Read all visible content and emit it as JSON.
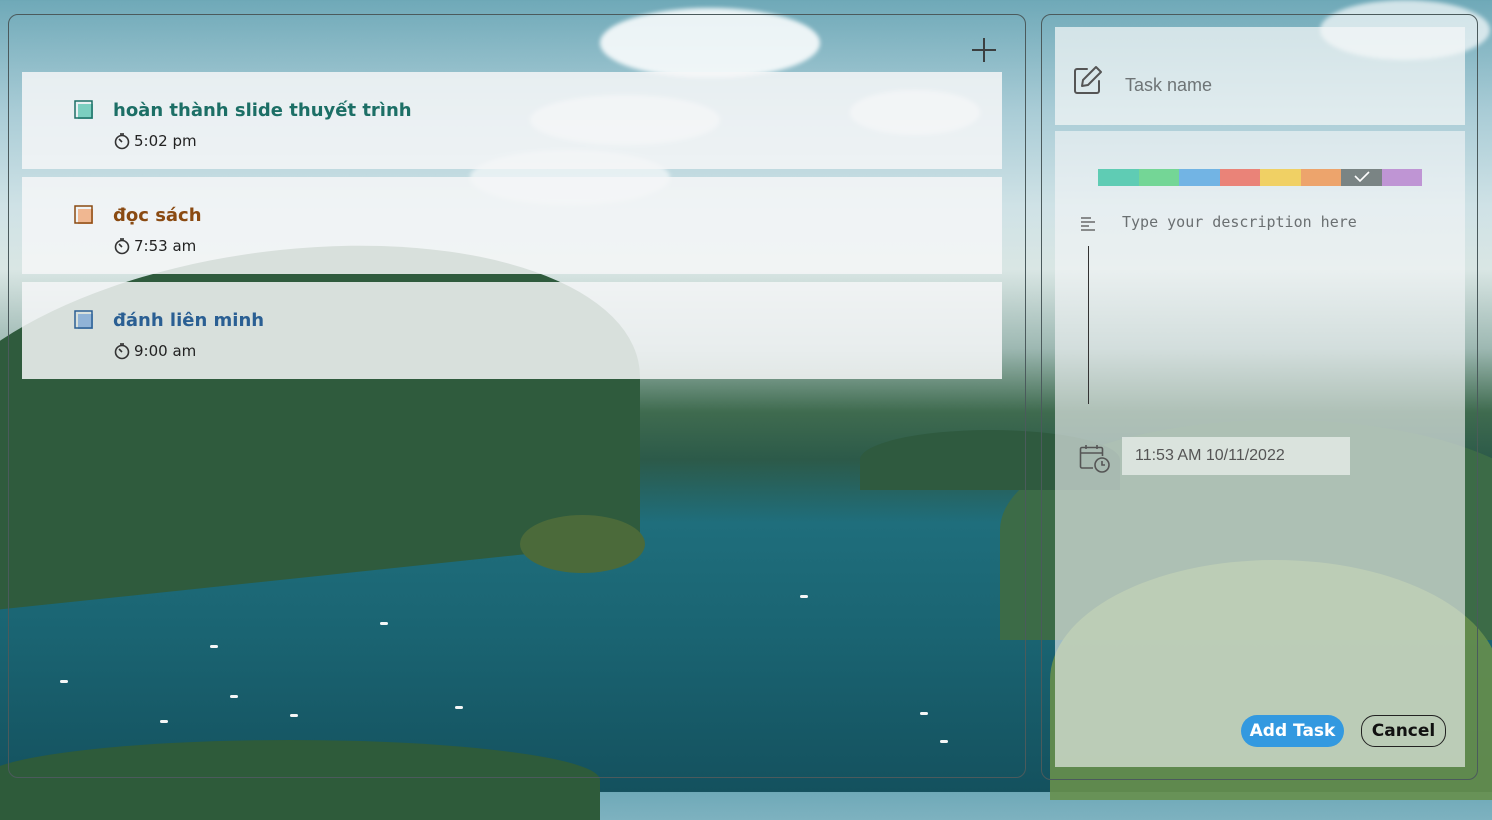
{
  "tasks": [
    {
      "title": "hoàn thành slide thuyết trình",
      "time": "5:02 pm",
      "color": "#1c6f66",
      "check_color": "#5fc7b3"
    },
    {
      "title": "đọc sách",
      "time": "7:53 am",
      "color": "#8a4a12",
      "check_color": "#f0a878"
    },
    {
      "title": "đánh liên minh",
      "time": "9:00 am",
      "color": "#2a5f93",
      "check_color": "#7ea8d6"
    }
  ],
  "form": {
    "task_name_placeholder": "Task name",
    "description_placeholder": "Type your description here",
    "datetime_value": "11:53 AM 10/11/2022",
    "add_label": "Add Task",
    "cancel_label": "Cancel",
    "colors": [
      "#5fccb4",
      "#74d696",
      "#72b4e4",
      "#ea8378",
      "#f0d064",
      "#eda46c",
      "#7a8484",
      "#bf95d4"
    ],
    "selected_color_index": 6
  },
  "icons": {
    "add": "plus-icon",
    "edit": "edit-icon",
    "description": "text-lines-icon",
    "calendar": "calendar-clock-icon",
    "time": "timer-icon"
  }
}
